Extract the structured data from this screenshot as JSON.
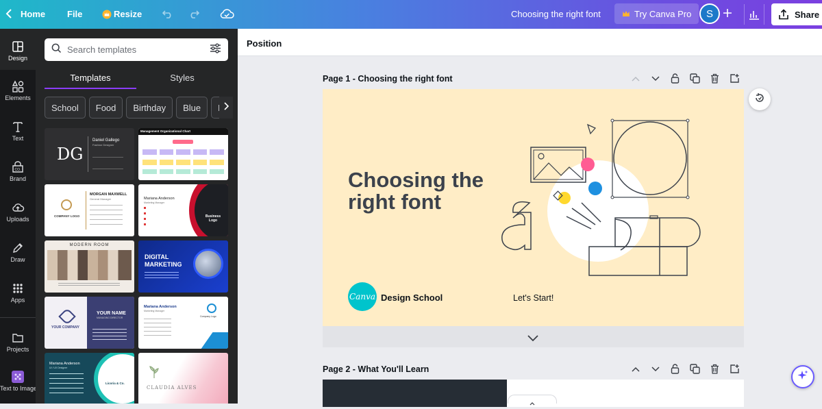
{
  "topbar": {
    "home_label": "Home",
    "file_label": "File",
    "resize_label": "Resize",
    "doc_title": "Choosing the right font",
    "pro_label": "Try Canva Pro",
    "avatar_initial": "S",
    "share_label": "Share"
  },
  "rail": {
    "items": [
      {
        "label": "Design",
        "icon": "layout-icon"
      },
      {
        "label": "Elements",
        "icon": "shapes-icon"
      },
      {
        "label": "Text",
        "icon": "text-icon"
      },
      {
        "label": "Brand",
        "icon": "brand-icon"
      },
      {
        "label": "Uploads",
        "icon": "cloud-upload-icon"
      },
      {
        "label": "Draw",
        "icon": "pen-icon"
      },
      {
        "label": "Apps",
        "icon": "grid-icon"
      },
      {
        "label": "Projects",
        "icon": "folder-icon"
      },
      {
        "label": "Text to Image",
        "icon": "image-gen-icon"
      }
    ]
  },
  "panel": {
    "search_placeholder": "Search templates",
    "tabs": [
      "Templates",
      "Styles"
    ],
    "chips": [
      "School",
      "Food",
      "Birthday",
      "Blue",
      "Back to"
    ],
    "templates": [
      {
        "name": "Daniel Gallego",
        "role": "Fashion Designer",
        "mono": "DG"
      },
      {
        "name": "Management Organizational Chart"
      },
      {
        "name": "MORGAN MAXWELL",
        "role": "General Manager",
        "logo": "COMPANY LOGO"
      },
      {
        "name": "Mariana Anderson",
        "role": "Marketing Manager",
        "logo": "Business Logo"
      },
      {
        "name": "MODERN ROOM"
      },
      {
        "name": "DIGITAL MARKETING"
      },
      {
        "name": "YOUR COMPANY",
        "title": "YOUR NAME",
        "role": "MANAGING DIRECTOR"
      },
      {
        "name": "Mariana Anderson",
        "role": "Marketing Manager",
        "logo": "Company Logo"
      },
      {
        "name": "Mariana Anderson",
        "role": "UI / UX Designer",
        "logo": "Licoria & Co."
      },
      {
        "name": "CLAUDIA ALVES"
      }
    ]
  },
  "canvas": {
    "position_label": "Position",
    "page1_label": "Page 1 - Choosing the right font",
    "page2_label": "Page 2 - What You'll Learn",
    "slide_title": "Choosing the right font",
    "brand_logo": "Canva",
    "brand_text": "Design School",
    "cta_text": "Let's Start!"
  },
  "colors": {
    "accent": "#8b3dff",
    "canvas_bg": "#ffedc6",
    "teal": "#00c4cc",
    "pink": "#ff5c93",
    "blue": "#1e90e0",
    "yellow": "#ffd82e"
  }
}
